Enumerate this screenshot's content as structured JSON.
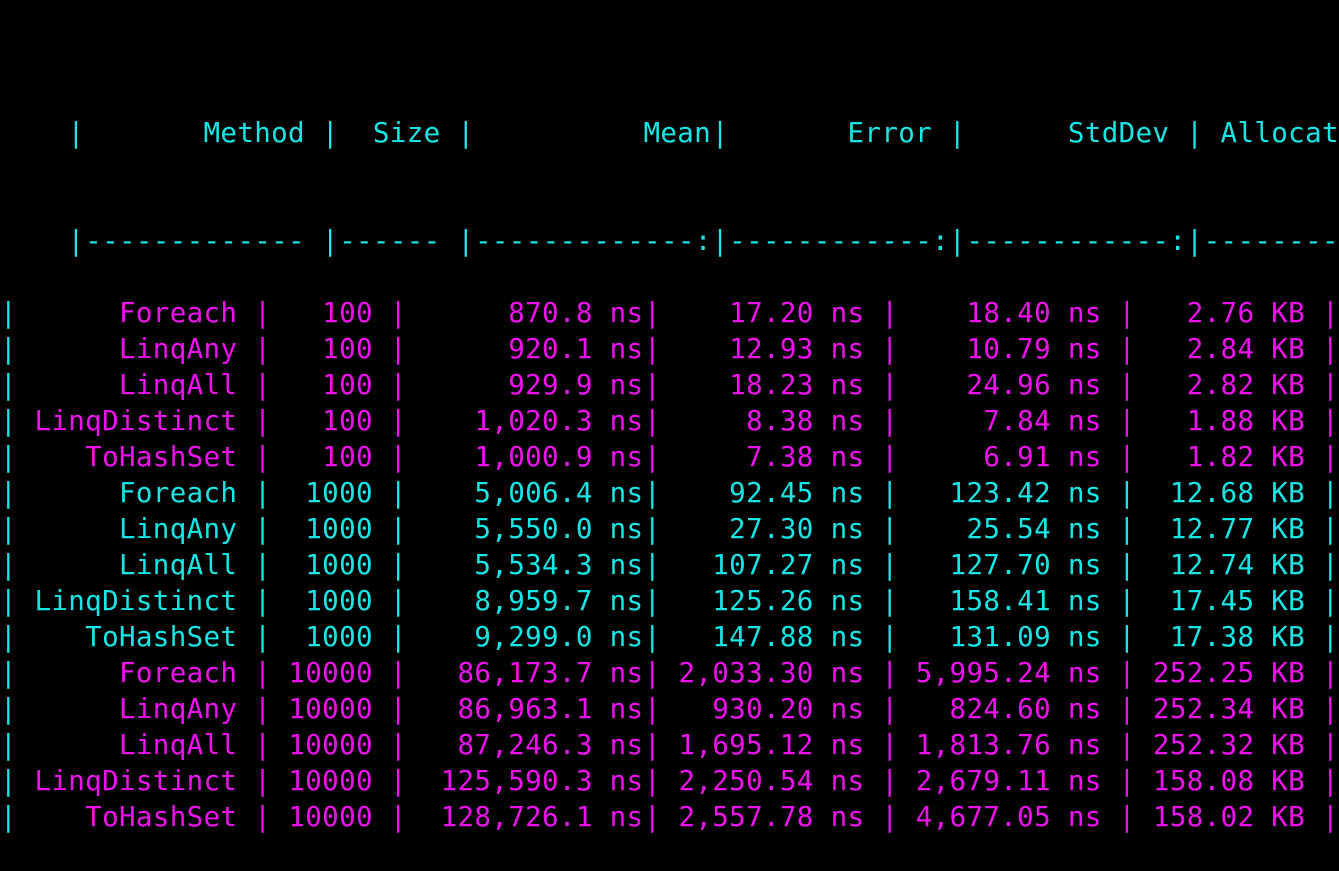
{
  "terminal": {
    "colors": {
      "cyan": "#16e6e6",
      "magenta": "#f010f0",
      "background": "#000000"
    },
    "header": [
      "       Method ",
      "  Size ",
      "          Mean ",
      "       Error ",
      "      StdDev ",
      " Allocated "
    ],
    "separator": [
      "------------- ",
      "------ ",
      "-------------:",
      "------------:",
      "------------:",
      "----------:"
    ],
    "rows": [
      {
        "color": "magenta",
        "cells": [
          "      Foreach ",
          "   100 ",
          "      870.8 ns ",
          "   17.20 ns ",
          "    18.40 ns ",
          "   2.76 KB "
        ]
      },
      {
        "color": "magenta",
        "cells": [
          "      LinqAny ",
          "   100 ",
          "      920.1 ns ",
          "   12.93 ns ",
          "    10.79 ns ",
          "   2.84 KB "
        ]
      },
      {
        "color": "magenta",
        "cells": [
          "      LinqAll ",
          "   100 ",
          "      929.9 ns ",
          "   18.23 ns ",
          "    24.96 ns ",
          "   2.82 KB "
        ]
      },
      {
        "color": "magenta",
        "cells": [
          " LinqDistinct ",
          "   100 ",
          "    1,020.3 ns ",
          "    8.38 ns ",
          "     7.84 ns ",
          "   1.88 KB "
        ]
      },
      {
        "color": "magenta",
        "cells": [
          "    ToHashSet ",
          "   100 ",
          "    1,000.9 ns ",
          "    7.38 ns ",
          "     6.91 ns ",
          "   1.82 KB "
        ]
      },
      {
        "color": "cyan",
        "cells": [
          "      Foreach ",
          "  1000 ",
          "    5,006.4 ns ",
          "   92.45 ns ",
          "   123.42 ns ",
          "  12.68 KB "
        ]
      },
      {
        "color": "cyan",
        "cells": [
          "      LinqAny ",
          "  1000 ",
          "    5,550.0 ns ",
          "   27.30 ns ",
          "    25.54 ns ",
          "  12.77 KB "
        ]
      },
      {
        "color": "cyan",
        "cells": [
          "      LinqAll ",
          "  1000 ",
          "    5,534.3 ns ",
          "  107.27 ns ",
          "   127.70 ns ",
          "  12.74 KB "
        ]
      },
      {
        "color": "cyan",
        "cells": [
          " LinqDistinct ",
          "  1000 ",
          "    8,959.7 ns ",
          "  125.26 ns ",
          "   158.41 ns ",
          "  17.45 KB "
        ]
      },
      {
        "color": "cyan",
        "cells": [
          "    ToHashSet ",
          "  1000 ",
          "    9,299.0 ns ",
          "  147.88 ns ",
          "   131.09 ns ",
          "  17.38 KB "
        ]
      },
      {
        "color": "magenta",
        "cells": [
          "      Foreach ",
          " 10000 ",
          "   86,173.7 ns ",
          " 2,033.30 ns ",
          " 5,995.24 ns ",
          " 252.25 KB "
        ]
      },
      {
        "color": "magenta",
        "cells": [
          "      LinqAny ",
          " 10000 ",
          "   86,963.1 ns ",
          "   930.20 ns ",
          "   824.60 ns ",
          " 252.34 KB "
        ]
      },
      {
        "color": "magenta",
        "cells": [
          "      LinqAll ",
          " 10000 ",
          "   87,246.3 ns ",
          " 1,695.12 ns ",
          " 1,813.76 ns ",
          " 252.32 KB "
        ]
      },
      {
        "color": "magenta",
        "cells": [
          " LinqDistinct ",
          " 10000 ",
          "  125,590.3 ns ",
          " 2,250.54 ns ",
          " 2,679.11 ns ",
          " 158.08 KB "
        ]
      },
      {
        "color": "magenta",
        "cells": [
          "    ToHashSet ",
          " 10000 ",
          "  128,726.1 ns ",
          " 2,557.78 ns ",
          " 4,677.05 ns ",
          " 158.02 KB "
        ]
      }
    ],
    "pipe_char": "|"
  }
}
